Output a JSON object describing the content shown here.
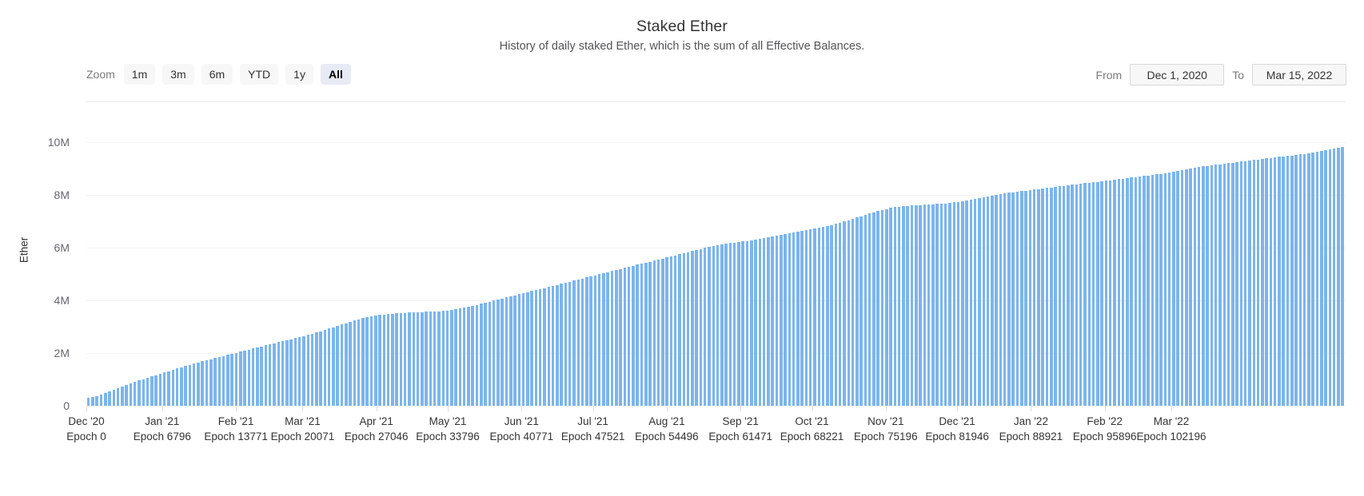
{
  "header": {
    "title": "Staked Ether",
    "subtitle": "History of daily staked Ether, which is the sum of all Effective Balances."
  },
  "range_selector": {
    "label": "Zoom",
    "buttons": [
      {
        "label": "1m",
        "selected": false
      },
      {
        "label": "3m",
        "selected": false
      },
      {
        "label": "6m",
        "selected": false
      },
      {
        "label": "YTD",
        "selected": false
      },
      {
        "label": "1y",
        "selected": false
      },
      {
        "label": "All",
        "selected": true
      }
    ]
  },
  "date_range": {
    "from_label": "From",
    "from_value": "Dec 1, 2020",
    "to_label": "To",
    "to_value": "Mar 15, 2022"
  },
  "chart_data": {
    "type": "bar",
    "title": "Staked Ether",
    "subtitle": "History of daily staked Ether, which is the sum of all Effective Balances.",
    "xlabel": "",
    "ylabel": "Ether",
    "ylim": [
      0,
      10000000
    ],
    "grid": true,
    "legend": false,
    "color": "#7cb5ec",
    "y_ticks": [
      0,
      2000000,
      4000000,
      6000000,
      8000000,
      10000000
    ],
    "y_tick_labels": [
      "0",
      "2M",
      "4M",
      "6M",
      "8M",
      "10M"
    ],
    "x_ticks": [
      {
        "month": "Dec '20",
        "epoch": "Epoch 0",
        "pos": 0.0
      },
      {
        "month": "Jan '21",
        "epoch": "Epoch 6796",
        "pos": 0.0602
      },
      {
        "month": "Feb '21",
        "epoch": "Epoch 13771",
        "pos": 0.1188
      },
      {
        "month": "Mar '21",
        "epoch": "Epoch 20071",
        "pos": 0.1717
      },
      {
        "month": "Apr '21",
        "epoch": "Epoch 27046",
        "pos": 0.2303
      },
      {
        "month": "May '21",
        "epoch": "Epoch 33796",
        "pos": 0.287
      },
      {
        "month": "Jun '21",
        "epoch": "Epoch 40771",
        "pos": 0.3456
      },
      {
        "month": "Jul '21",
        "epoch": "Epoch 47521",
        "pos": 0.4023
      },
      {
        "month": "Aug '21",
        "epoch": "Epoch 54496",
        "pos": 0.4609
      },
      {
        "month": "Sep '21",
        "epoch": "Epoch 61471",
        "pos": 0.5195
      },
      {
        "month": "Oct '21",
        "epoch": "Epoch 68221",
        "pos": 0.5762
      },
      {
        "month": "Nov '21",
        "epoch": "Epoch 75196",
        "pos": 0.6348
      },
      {
        "month": "Dec '21",
        "epoch": "Epoch 81946",
        "pos": 0.6915
      },
      {
        "month": "Jan '22",
        "epoch": "Epoch 88921",
        "pos": 0.7501
      },
      {
        "month": "Feb '22",
        "epoch": "Epoch 95896",
        "pos": 0.8087
      },
      {
        "month": "Mar '22",
        "epoch": "Epoch 102196",
        "pos": 0.8616
      }
    ],
    "series": [
      {
        "name": "Staked Ether",
        "values": [
          300000,
          330000,
          370000,
          420000,
          480000,
          540000,
          600000,
          660000,
          720000,
          780000,
          840000,
          900000,
          960000,
          1010000,
          1060000,
          1110000,
          1160000,
          1210000,
          1260000,
          1310000,
          1360000,
          1410000,
          1460000,
          1510000,
          1560000,
          1610000,
          1650000,
          1690000,
          1730000,
          1770000,
          1810000,
          1850000,
          1890000,
          1930000,
          1970000,
          2010000,
          2050000,
          2090000,
          2130000,
          2170000,
          2210000,
          2250000,
          2290000,
          2330000,
          2370000,
          2410000,
          2450000,
          2490000,
          2530000,
          2570000,
          2610000,
          2650000,
          2690000,
          2730000,
          2780000,
          2830000,
          2880000,
          2930000,
          2980000,
          3030000,
          3080000,
          3130000,
          3180000,
          3230000,
          3280000,
          3320000,
          3360000,
          3400000,
          3430000,
          3450000,
          3470000,
          3490000,
          3500000,
          3510000,
          3520000,
          3530000,
          3540000,
          3550000,
          3555000,
          3560000,
          3565000,
          3570000,
          3580000,
          3590000,
          3600000,
          3620000,
          3640000,
          3660000,
          3690000,
          3720000,
          3750000,
          3790000,
          3830000,
          3870000,
          3910000,
          3950000,
          3990000,
          4030000,
          4070000,
          4110000,
          4150000,
          4190000,
          4230000,
          4270000,
          4310000,
          4350000,
          4390000,
          4430000,
          4470000,
          4510000,
          4550000,
          4590000,
          4630000,
          4670000,
          4710000,
          4750000,
          4790000,
          4830000,
          4870000,
          4910000,
          4950000,
          4990000,
          5030000,
          5070000,
          5110000,
          5150000,
          5190000,
          5230000,
          5270000,
          5310000,
          5350000,
          5390000,
          5430000,
          5470000,
          5510000,
          5550000,
          5590000,
          5630000,
          5670000,
          5710000,
          5750000,
          5790000,
          5830000,
          5870000,
          5910000,
          5950000,
          5990000,
          6020000,
          6050000,
          6080000,
          6110000,
          6140000,
          6170000,
          6190000,
          6210000,
          6230000,
          6250000,
          6280000,
          6310000,
          6340000,
          6370000,
          6400000,
          6430000,
          6460000,
          6490000,
          6520000,
          6550000,
          6580000,
          6610000,
          6640000,
          6670000,
          6700000,
          6730000,
          6760000,
          6790000,
          6820000,
          6860000,
          6900000,
          6940000,
          6990000,
          7040000,
          7090000,
          7140000,
          7190000,
          7240000,
          7290000,
          7340000,
          7390000,
          7430000,
          7470000,
          7510000,
          7540000,
          7560000,
          7580000,
          7590000,
          7600000,
          7610000,
          7620000,
          7630000,
          7640000,
          7650000,
          7660000,
          7670000,
          7680000,
          7700000,
          7720000,
          7740000,
          7760000,
          7790000,
          7820000,
          7850000,
          7880000,
          7910000,
          7940000,
          7970000,
          8000000,
          8030000,
          8060000,
          8080000,
          8100000,
          8120000,
          8140000,
          8160000,
          8180000,
          8200000,
          8220000,
          8240000,
          8260000,
          8280000,
          8300000,
          8320000,
          8340000,
          8360000,
          8380000,
          8400000,
          8420000,
          8440000,
          8460000,
          8480000,
          8500000,
          8520000,
          8540000,
          8560000,
          8580000,
          8600000,
          8620000,
          8640000,
          8660000,
          8680000,
          8700000,
          8720000,
          8740000,
          8760000,
          8780000,
          8800000,
          8830000,
          8860000,
          8890000,
          8920000,
          8950000,
          8980000,
          9010000,
          9040000,
          9060000,
          9080000,
          9100000,
          9120000,
          9140000,
          9160000,
          9180000,
          9200000,
          9220000,
          9240000,
          9260000,
          9280000,
          9300000,
          9320000,
          9340000,
          9360000,
          9380000,
          9400000,
          9420000,
          9440000,
          9460000,
          9480000,
          9500000,
          9520000,
          9540000,
          9560000,
          9590000,
          9620000,
          9650000,
          9680000,
          9710000,
          9740000,
          9770000,
          9800000,
          9830000
        ]
      }
    ]
  }
}
